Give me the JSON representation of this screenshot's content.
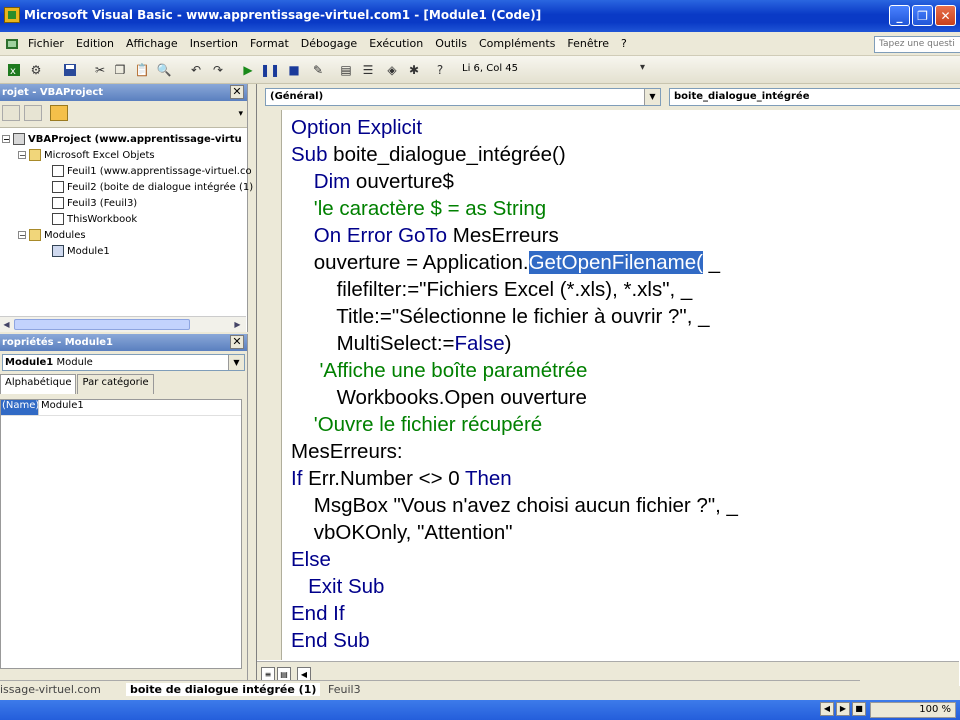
{
  "window": {
    "title": "Microsoft Visual Basic - www.apprentissage-virtuel.com1 - [Module1 (Code)]",
    "min": "_",
    "max": "❐",
    "close": "✕"
  },
  "menu": {
    "items": [
      "Fichier",
      "Edition",
      "Affichage",
      "Insertion",
      "Format",
      "Débogage",
      "Exécution",
      "Outils",
      "Compléments",
      "Fenêtre",
      "?"
    ],
    "help_placeholder": "Tapez une questi"
  },
  "toolbar": {
    "position": "Li 6, Col 45",
    "grip": "▾"
  },
  "project": {
    "title": "rojet - VBAProject",
    "close": "✕",
    "tree": [
      {
        "label": "VBAProject (www.apprentissage-virtu"
      },
      {
        "label": "Microsoft Excel Objets"
      },
      {
        "label": "Feuil1 (www.apprentissage-virtuel.co"
      },
      {
        "label": "Feuil2 (boite de dialogue intégrée (1)"
      },
      {
        "label": "Feuil3 (Feuil3)"
      },
      {
        "label": "ThisWorkbook"
      },
      {
        "label": "Modules"
      },
      {
        "label": "Module1"
      }
    ]
  },
  "properties": {
    "title": "ropriétés - Module1",
    "close": "✕",
    "object_name": "Module1",
    "object_type": "Module",
    "tabs": [
      "Alphabétique",
      "Par catégorie"
    ],
    "rows": [
      {
        "key": "(Name)",
        "value": "Module1"
      }
    ]
  },
  "code": {
    "object_combo": "(Général)",
    "proc_combo": "boite_dialogue_intégrée",
    "lines": [
      [
        {
          "t": "Option Explicit",
          "c": "kw"
        }
      ],
      [
        {
          "t": "Sub",
          "c": "kw"
        },
        {
          "t": " boite_dialogue_intégrée()",
          "c": ""
        }
      ],
      [
        {
          "t": "    ",
          "c": ""
        },
        {
          "t": "Dim",
          "c": "kw"
        },
        {
          "t": " ouverture$",
          "c": ""
        }
      ],
      [
        {
          "t": "    ",
          "c": ""
        },
        {
          "t": "'le caractère $ = as String",
          "c": "cm"
        }
      ],
      [
        {
          "t": "    ",
          "c": ""
        },
        {
          "t": "On Error GoTo",
          "c": "kw"
        },
        {
          "t": " MesErreurs",
          "c": ""
        }
      ],
      [
        {
          "t": "    ouverture = Application.",
          "c": ""
        },
        {
          "t": "GetOpenFilename(",
          "c": "hl"
        },
        {
          "t": " _",
          "c": ""
        }
      ],
      [
        {
          "t": "        filefilter:=\"Fichiers Excel (*.xls), *.xls\", _",
          "c": ""
        }
      ],
      [
        {
          "t": "        Title:=\"Sélectionne le fichier à ouvrir ?\", _",
          "c": ""
        }
      ],
      [
        {
          "t": "        MultiSelect:=",
          "c": ""
        },
        {
          "t": "False",
          "c": "kw"
        },
        {
          "t": ")",
          "c": ""
        }
      ],
      [
        {
          "t": "     ",
          "c": ""
        },
        {
          "t": "'Affiche une boîte paramétrée",
          "c": "cm"
        }
      ],
      [
        {
          "t": "        Workbooks.Open ouverture",
          "c": ""
        }
      ],
      [
        {
          "t": "    ",
          "c": ""
        },
        {
          "t": "'Ouvre le fichier récupéré",
          "c": "cm"
        }
      ],
      [
        {
          "t": "MesErreurs:",
          "c": ""
        }
      ],
      [
        {
          "t": "If",
          "c": "kw"
        },
        {
          "t": " Err.Number <> 0 ",
          "c": ""
        },
        {
          "t": "Then",
          "c": "kw"
        }
      ],
      [
        {
          "t": "    MsgBox \"Vous n'avez choisi aucun fichier ?\", _",
          "c": ""
        }
      ],
      [
        {
          "t": "    vbOKOnly, \"Attention\"",
          "c": ""
        }
      ],
      [
        {
          "t": "Else",
          "c": "kw"
        }
      ],
      [
        {
          "t": "   ",
          "c": ""
        },
        {
          "t": "Exit Sub",
          "c": "kw"
        }
      ],
      [
        {
          "t": "End If",
          "c": "kw"
        }
      ],
      [
        {
          "t": "End Sub",
          "c": "kw"
        }
      ]
    ]
  },
  "sheettabs": [
    "issage-virtuel.com",
    "boite de dialogue intégrée (1)",
    "Feuil3"
  ],
  "status": {
    "zoom": "100 %"
  }
}
